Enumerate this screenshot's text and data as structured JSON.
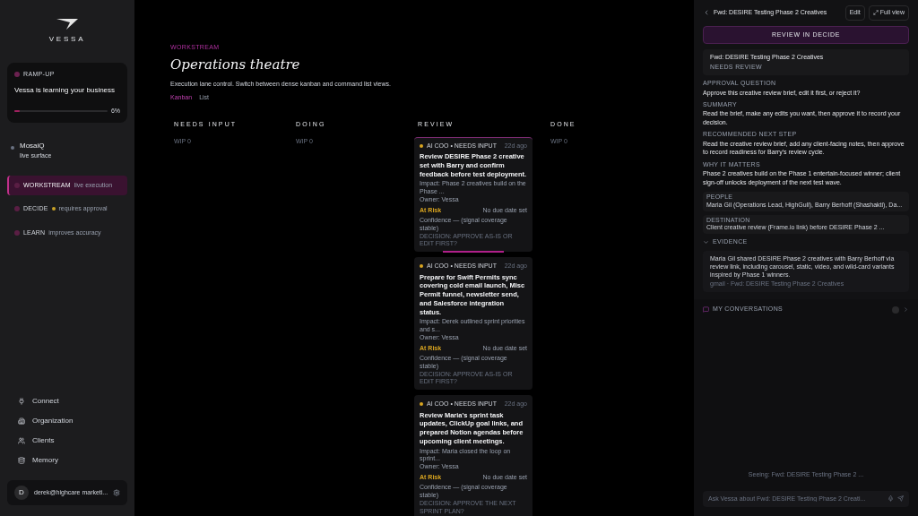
{
  "sidebar": {
    "brand": "VESSA",
    "ramp_up": {
      "label": "RAMP-UP",
      "title": "Vessa is learning your business",
      "level": 0.06,
      "reading": "6%"
    },
    "surface": {
      "name": "MosaiQ",
      "caption": "live surface"
    },
    "nav": [
      {
        "label": "WORKSTREAM",
        "caption": "live execution",
        "selected": true,
        "alert": false
      },
      {
        "label": "DECIDE",
        "caption": "requires approval",
        "selected": false,
        "alert": true
      },
      {
        "label": "LEARN",
        "caption": "improves accuracy",
        "selected": false,
        "alert": false
      }
    ],
    "links": [
      {
        "kind": "plug",
        "label": "Connect"
      },
      {
        "kind": "building",
        "label": "Organization"
      },
      {
        "kind": "users",
        "label": "Clients"
      },
      {
        "kind": "database",
        "label": "Memory"
      }
    ],
    "user": {
      "initial": "D",
      "email": "derek@highcare marketi..."
    }
  },
  "main": {
    "eyebrow": "WORKSTREAM",
    "title": "Operations theatre",
    "subtitle": "Execution lane control. Switch between dense kanban and command list views.",
    "views": [
      {
        "label": "Kanban",
        "selected": true
      },
      {
        "label": "List",
        "selected": false
      }
    ],
    "columns": [
      {
        "title": "NEEDS INPUT",
        "count": "WIP 0"
      },
      {
        "title": "DOING",
        "count": "WIP 0"
      },
      {
        "title": "REVIEW",
        "cards": [
          {
            "tag": "AI COO • NEEDS INPUT",
            "meta": "22d ago",
            "title": "Review DESIRE Phase 2 creative set with Barry and confirm feedback before test deployment.",
            "impact": "Impact: Phase 2 creatives build on the Phase ...",
            "owner": "Owner: Vessa",
            "risk": "At Risk",
            "due": "No due date set",
            "confidence": "Confidence — (signal coverage stable)",
            "decision": "DECISION: APPROVE AS-IS OR EDIT FIRST?",
            "selected": true
          },
          {
            "tag": "AI COO • NEEDS INPUT",
            "meta": "22d ago",
            "title": "Prepare for Swift Permits sync covering cold email launch, Misc Permit funnel, newsletter send, and Salesforce integration status.",
            "impact": "Impact: Derek outlined sprint priorities and s...",
            "owner": "Owner: Vessa",
            "risk": "At Risk",
            "due": "No due date set",
            "confidence": "Confidence — (signal coverage stable)",
            "decision": "DECISION: APPROVE AS-IS OR EDIT FIRST?",
            "selected": false
          },
          {
            "tag": "AI COO • NEEDS INPUT",
            "meta": "22d ago",
            "title": "Review Maria's sprint task updates, ClickUp goal links, and prepared Notion agendas before upcoming client meetings.",
            "impact": "Impact: Maria closed the loop on sprint...",
            "owner": "Owner: Vessa",
            "risk": "At Risk",
            "due": "No due date set",
            "confidence": "Confidence — (signal coverage stable)",
            "decision": "DECISION: APPROVE THE NEXT SPRINT PLAN?",
            "selected": false
          }
        ]
      },
      {
        "title": "DONE",
        "count": "WIP 0"
      }
    ]
  },
  "detail": {
    "title": "Fwd: DESIRE Testing Phase 2 Creatives",
    "edit": "Edit",
    "full_view": "Full view",
    "primary": "REVIEW IN DECIDE",
    "item": {
      "title": "Fwd: DESIRE Testing Phase 2 Creatives",
      "status": "NEEDS REVIEW"
    },
    "sections": [
      {
        "label": "APPROVAL QUESTION",
        "text": "Approve this creative review brief, edit it first, or reject it?"
      },
      {
        "label": "SUMMARY",
        "text": "Read the brief, make any edits you want, then approve it to record your decision."
      },
      {
        "label": "RECOMMENDED NEXT STEP",
        "text": "Read the creative review brief, add any client-facing notes, then approve to record readiness for Barry's review cycle."
      },
      {
        "label": "WHY IT MATTERS",
        "text": "Phase 2 creatives build on the Phase 1 entertain-focused winner; client sign-off unlocks deployment of the next test wave."
      }
    ],
    "chips": [
      {
        "label": "PEOPLE",
        "text": "Maria Gil (Operations Lead, HighGull), Barry Berhoff (Shashakti), Da..."
      },
      {
        "label": "DESTINATION",
        "text": "Client creative review (Frame.io link) before DESIRE Phase 2 ..."
      }
    ],
    "evidence": {
      "label": "EVIDENCE",
      "expanded": true,
      "text": "Maria Gil shared DESIRE Phase 2 creatives with Barry Berhoff via review link, including carousel, static, video, and wild-card variants inspired by Phase 1 winners.",
      "source": "gmail · Fwd: DESIRE Testing Phase 2 Creatives"
    },
    "conversations": {
      "label": "MY CONVERSATIONS",
      "seeing": "Seeing: Fwd: DESIRE Testing Phase 2 ...",
      "placeholder": "Ask Vessa about Fwd: DESIRE Testing Phase 2 Creati..."
    }
  }
}
